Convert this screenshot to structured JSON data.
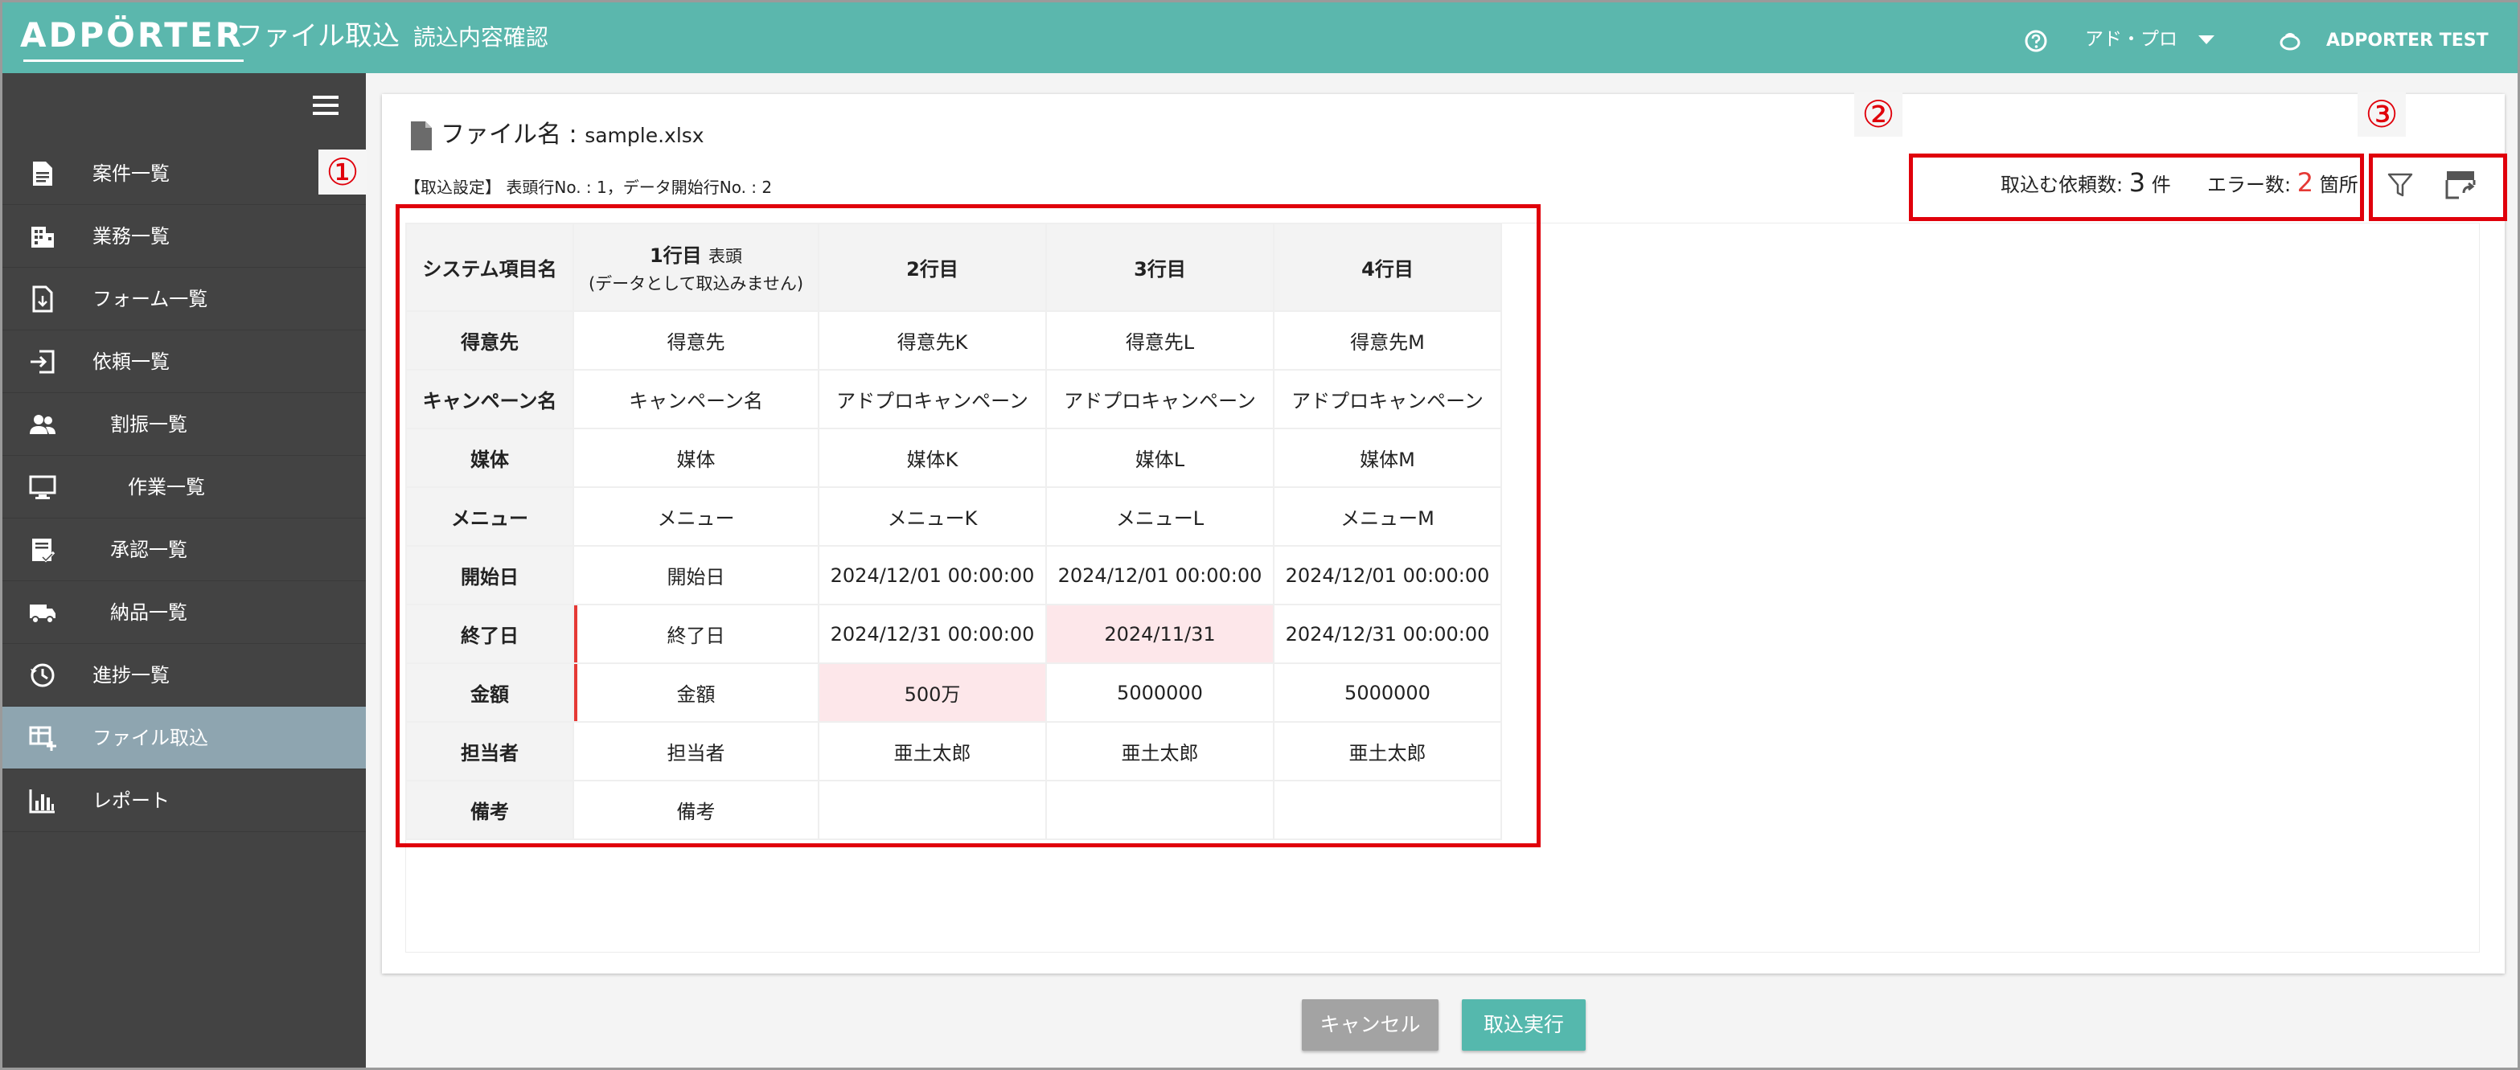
{
  "header": {
    "logo": "ADPÖRTER",
    "title": "ファイル取込",
    "subtitle": "読込内容確認",
    "org": "アド・プロ",
    "user": "ADPORTER TEST",
    "bg_color": "#5bb7ad"
  },
  "sidebar": {
    "items": [
      {
        "label": "案件一覧",
        "icon": "document-icon"
      },
      {
        "label": "業務一覧",
        "icon": "building-icon"
      },
      {
        "label": "フォーム一覧",
        "icon": "form-icon"
      },
      {
        "label": "依頼一覧",
        "icon": "login-icon"
      },
      {
        "label": "割振一覧",
        "icon": "people-icon"
      },
      {
        "label": "作業一覧",
        "icon": "monitor-icon"
      },
      {
        "label": "承認一覧",
        "icon": "approval-icon"
      },
      {
        "label": "納品一覧",
        "icon": "truck-icon"
      },
      {
        "label": "進捗一覧",
        "icon": "history-icon"
      },
      {
        "label": "ファイル取込",
        "icon": "table-add-icon",
        "active": true
      },
      {
        "label": "レポート",
        "icon": "bar-chart-icon"
      }
    ],
    "bg_color": "#434343",
    "active_color": "#8ea5b0"
  },
  "main": {
    "file_label": "ファイル名 :",
    "file_name": "sample.xlsx",
    "settings": "【取込設定】 表頭行No. : 1，データ開始行No. : 2",
    "summary": {
      "import_label": "取込む依頼数:",
      "import_count": "3",
      "import_unit": "件",
      "error_label": "エラー数:",
      "error_count": "2",
      "error_unit": "箇所"
    },
    "table": {
      "corner": "システム項目名",
      "col1_title": "1行目",
      "col1_tag": "表頭",
      "col1_note": "(データとして取込みません)",
      "cols": [
        "2行目",
        "3行目",
        "4行目"
      ],
      "rows": [
        {
          "name": "得意先",
          "cells": [
            "得意先",
            "得意先K",
            "得意先L",
            "得意先M"
          ]
        },
        {
          "name": "キャンペーン名",
          "cells": [
            "キャンペーン名",
            "アドプロキャンペーン",
            "アドプロキャンペーン",
            "アドプロキャンペーン"
          ]
        },
        {
          "name": "媒体",
          "cells": [
            "媒体",
            "媒体K",
            "媒体L",
            "媒体M"
          ]
        },
        {
          "name": "メニュー",
          "cells": [
            "メニュー",
            "メニューK",
            "メニューL",
            "メニューM"
          ]
        },
        {
          "name": "開始日",
          "cells": [
            "開始日",
            "2024/12/01 00:00:00",
            "2024/12/01 00:00:00",
            "2024/12/01 00:00:00"
          ]
        },
        {
          "name": "終了日",
          "cells": [
            "終了日",
            "2024/12/31 00:00:00",
            "2024/11/31",
            "2024/12/31 00:00:00"
          ]
        },
        {
          "name": "金額",
          "cells": [
            "金額",
            "500万",
            "5000000",
            "5000000"
          ]
        },
        {
          "name": "担当者",
          "cells": [
            "担当者",
            "亜土太郎",
            "亜土太郎",
            "亜土太郎"
          ]
        },
        {
          "name": "備考",
          "cells": [
            "備考",
            "",
            "",
            ""
          ]
        }
      ]
    }
  },
  "callouts": [
    "①",
    "②",
    "③"
  ],
  "buttons": {
    "cancel": "キャンセル",
    "run": "取込実行"
  },
  "colors": {
    "error_cell": "#fde7ea",
    "error_text": "#e53935",
    "annotation": "#e0000b"
  }
}
